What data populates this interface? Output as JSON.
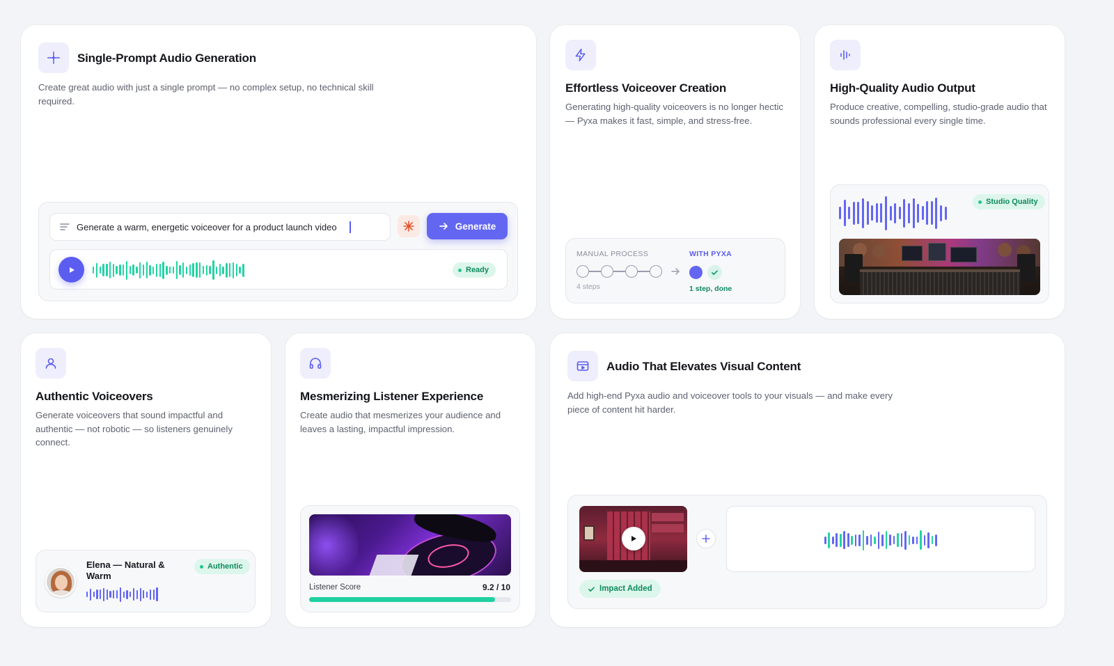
{
  "colors": {
    "accent": "#6366f1",
    "accent_dark": "#5b5cf0",
    "teal": "#22d3a4",
    "success_text": "#0f8a5f",
    "success_bg": "#ddf6ec",
    "icon_bg": "#eeeefc"
  },
  "card_prompt": {
    "icon": "sparkle-icon",
    "title": "Single-Prompt Audio Generation",
    "description": "Create great audio with just a single prompt — no complex setup, no technical skill required.",
    "prompt_text": "Generate a warm, energetic voiceover for a product launch video",
    "generate_label": "Generate",
    "status_label": "Ready"
  },
  "card_voiceover": {
    "icon": "lightning-icon",
    "title": "Effortless Voiceover Creation",
    "description": "Generating high-quality voiceovers is no longer hectic — Pyxa makes it fast, simple, and stress-free.",
    "manual_label": "MANUAL PROCESS",
    "manual_caption": "4 steps",
    "pyxa_label": "WITH PYXA",
    "pyxa_caption": "1 step, done"
  },
  "card_quality": {
    "icon": "waveform-icon",
    "title": "High-Quality Audio Output",
    "description": "Produce creative, compelling, studio-grade audio that sounds professional every single time.",
    "badge": "Studio Quality"
  },
  "card_authentic": {
    "icon": "user-icon",
    "title": "Authentic Voiceovers",
    "description": "Generate voiceovers that sound impactful and authentic — not robotic — so listeners genuinely connect.",
    "voice_name": "Elena — Natural & Warm",
    "badge": "Authentic"
  },
  "card_listener": {
    "icon": "headphones-icon",
    "title": "Mesmerizing Listener Experience",
    "description": "Create audio that mesmerizes your audience and leaves a lasting, impactful impression.",
    "score_label": "Listener Score",
    "score_value": "9.2 / 10",
    "score_fraction": 0.92
  },
  "card_visual": {
    "icon": "video-icon",
    "title": "Audio That Elevates Visual Content",
    "description": "Add high-end Pyxa audio and voiceover tools to your visuals — and make every piece of content hit harder.",
    "badge": "Impact Added"
  }
}
